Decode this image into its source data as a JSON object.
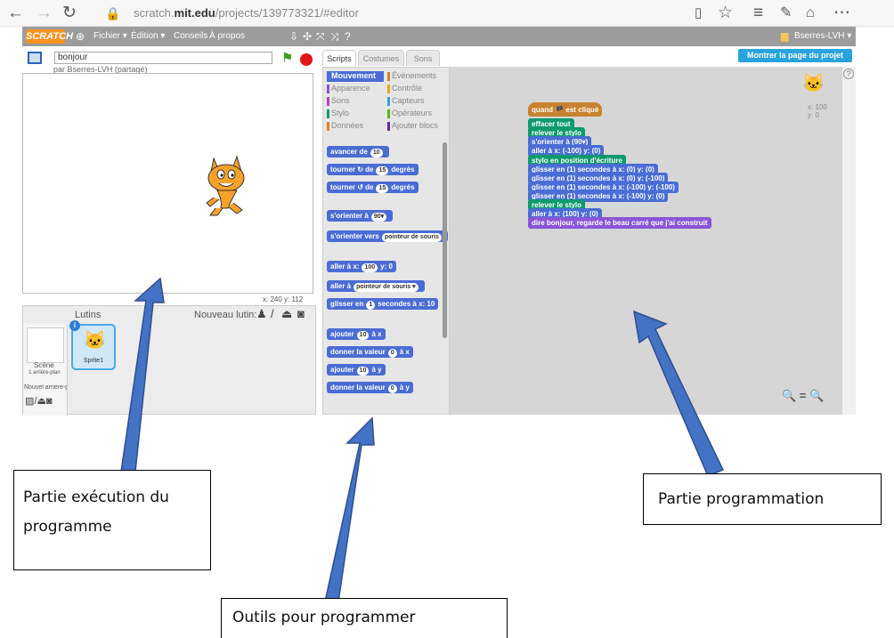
{
  "browser": {
    "url_prefix": "scratch.",
    "url_domain": "mit.edu",
    "url_path": "/projects/139773321/#editor"
  },
  "menu": {
    "logo": "SCRATCH",
    "file": "Fichier ▾",
    "edit": "Édition ▾",
    "tips": "Conseils",
    "about": "À propos",
    "user": "Bserres-LVH ▾"
  },
  "project": {
    "link": "Montrer la page du projet",
    "title": "bonjour",
    "owner": "par Bserres-LVH (partagé)",
    "coords": "x: 240  y: 112"
  },
  "sprites": {
    "header": "Lutins",
    "new_sprite": "Nouveau lutin:",
    "stage_label": "Scène",
    "stage_sub": "1 arrière-plan",
    "new_backdrop": "Nouvel arrière-p",
    "sprite_name": "Sprite1"
  },
  "tabs": {
    "scripts": "Scripts",
    "costumes": "Costumes",
    "sounds": "Sons"
  },
  "categories": [
    {
      "label": "Mouvement",
      "color": "#4a6cd4"
    },
    {
      "label": "Événements",
      "color": "#c88330"
    },
    {
      "label": "Apparence",
      "color": "#8a55d7"
    },
    {
      "label": "Contrôle",
      "color": "#e1a91a"
    },
    {
      "label": "Sons",
      "color": "#bb42c3"
    },
    {
      "label": "Capteurs",
      "color": "#2ca5e2"
    },
    {
      "label": "Stylo",
      "color": "#0e9a6c"
    },
    {
      "label": "Opérateurs",
      "color": "#5cb712"
    },
    {
      "label": "Données",
      "color": "#ee7d16"
    },
    {
      "label": "Ajouter blocs",
      "color": "#632d99"
    }
  ],
  "palette_blocks": [
    {
      "text": "avancer de",
      "val": "10",
      "after": ""
    },
    {
      "text": "tourner ↻ de",
      "val": "15",
      "after": "degrés"
    },
    {
      "text": "tourner ↺ de",
      "val": "15",
      "after": "degrés"
    },
    {
      "text": "s'orienter à",
      "val": "90▾",
      "after": ""
    },
    {
      "text": "s'orienter vers",
      "val": "pointeur de souris",
      "after": ""
    },
    {
      "text": "aller à x:",
      "val": "100",
      "after": "y: 0"
    },
    {
      "text": "aller à",
      "val": "pointeur de souris ▾",
      "after": ""
    },
    {
      "text": "glisser en",
      "val": "1",
      "after": "secondes à x: 10"
    },
    {
      "text": "ajouter",
      "val": "10",
      "after": "à x"
    },
    {
      "text": "donner la valeur",
      "val": "0",
      "after": "à x"
    },
    {
      "text": "ajouter",
      "val": "10",
      "after": "à y"
    },
    {
      "text": "donner la valeur",
      "val": "0",
      "after": "à y"
    }
  ],
  "script_blocks": [
    {
      "text": "quand 🏴 est cliqué",
      "color": "#c88330"
    },
    {
      "text": "effacer tout",
      "color": "#0e9a6c"
    },
    {
      "text": "relever le stylo",
      "color": "#0e9a6c"
    },
    {
      "text": "s'orienter à (90▾)",
      "color": "#4a6cd4"
    },
    {
      "text": "aller à x: (-100) y: (0)",
      "color": "#4a6cd4"
    },
    {
      "text": "stylo en position d'écriture",
      "color": "#0e9a6c"
    },
    {
      "text": "glisser en (1) secondes à x: (0) y: (0)",
      "color": "#4a6cd4"
    },
    {
      "text": "glisser en (1) secondes à x: (0) y: (-100)",
      "color": "#4a6cd4"
    },
    {
      "text": "glisser en (1) secondes à x: (-100) y: (-100)",
      "color": "#4a6cd4"
    },
    {
      "text": "glisser en (1) secondes à x: (-100) y: (0)",
      "color": "#4a6cd4"
    },
    {
      "text": "relever le stylo",
      "color": "#0e9a6c"
    },
    {
      "text": "aller à x: (100) y: (0)",
      "color": "#4a6cd4"
    },
    {
      "text": "dire bonjour, regarde le beau carré que j'ai construit",
      "color": "#8a55d7"
    }
  ],
  "sprite_info": {
    "x": "x: 100",
    "y": "y: 0"
  },
  "zoom": "🔍 = 🔍",
  "callouts": {
    "execution": "Partie exécution du programme",
    "tools": "Outils pour programmer",
    "programming": "Partie programmation"
  }
}
